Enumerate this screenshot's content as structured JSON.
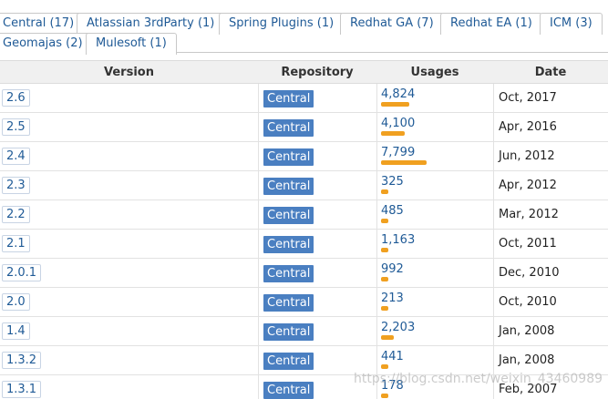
{
  "tabs": [
    {
      "label": "Central (17)"
    },
    {
      "label": "Atlassian 3rdParty (1)"
    },
    {
      "label": "Spring Plugins (1)"
    },
    {
      "label": "Redhat GA (7)"
    },
    {
      "label": "Redhat EA (1)"
    },
    {
      "label": "ICM (3)"
    },
    {
      "label": "Geomajas (2)"
    },
    {
      "label": "Mulesoft (1)"
    }
  ],
  "table": {
    "headers": {
      "version": "Version",
      "repository": "Repository",
      "usages": "Usages",
      "date": "Date"
    },
    "rows": [
      {
        "version": "2.6",
        "repository": "Central",
        "usages": "4,824",
        "usage_value": 4824,
        "date": "Oct, 2017"
      },
      {
        "version": "2.5",
        "repository": "Central",
        "usages": "4,100",
        "usage_value": 4100,
        "date": "Apr, 2016"
      },
      {
        "version": "2.4",
        "repository": "Central",
        "usages": "7,799",
        "usage_value": 7799,
        "date": "Jun, 2012"
      },
      {
        "version": "2.3",
        "repository": "Central",
        "usages": "325",
        "usage_value": 325,
        "date": "Apr, 2012"
      },
      {
        "version": "2.2",
        "repository": "Central",
        "usages": "485",
        "usage_value": 485,
        "date": "Mar, 2012"
      },
      {
        "version": "2.1",
        "repository": "Central",
        "usages": "1,163",
        "usage_value": 1163,
        "date": "Oct, 2011"
      },
      {
        "version": "2.0.1",
        "repository": "Central",
        "usages": "992",
        "usage_value": 992,
        "date": "Dec, 2010"
      },
      {
        "version": "2.0",
        "repository": "Central",
        "usages": "213",
        "usage_value": 213,
        "date": "Oct, 2010"
      },
      {
        "version": "1.4",
        "repository": "Central",
        "usages": "2,203",
        "usage_value": 2203,
        "date": "Jan, 2008"
      },
      {
        "version": "1.3.2",
        "repository": "Central",
        "usages": "441",
        "usage_value": 441,
        "date": "Jan, 2008"
      },
      {
        "version": "1.3.1",
        "repository": "Central",
        "usages": "178",
        "usage_value": 178,
        "date": "Feb, 2007"
      }
    ]
  },
  "watermark": "https://blog.csdn.net/weixin_43460989",
  "colors": {
    "link": "#1f5a96",
    "repo_badge": "#4a7fc1",
    "usage_bar": "#f0a020"
  }
}
